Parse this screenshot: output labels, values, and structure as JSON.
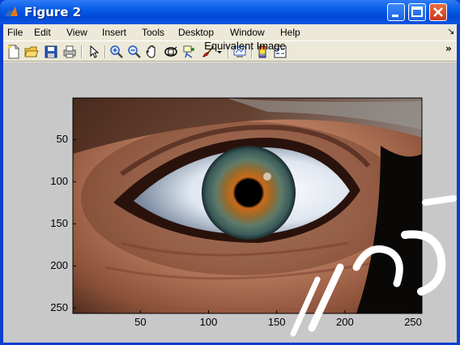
{
  "window": {
    "title": "Figure 2",
    "icon": "matlab-icon",
    "controls": [
      "minimize-icon",
      "maximize-icon",
      "close-icon"
    ]
  },
  "menu": {
    "items": [
      "File",
      "Edit",
      "View",
      "Insert",
      "Tools",
      "Desktop",
      "Window",
      "Help"
    ],
    "overflow": "↘"
  },
  "toolbar": {
    "tools": [
      "new-figure-icon",
      "open-file-icon",
      "save-icon",
      "print-icon",
      "pointer-icon",
      "zoom-in-icon",
      "zoom-out-icon",
      "pan-hand-icon",
      "rotate-3d-icon",
      "data-cursor-icon",
      "brush-icon",
      "brush-dropdown-icon",
      "link-plot-icon",
      "colorbar-icon",
      "legend-icon"
    ],
    "overflow": "»"
  },
  "axes": {
    "title": "Equivalent Image",
    "y_ticks": [
      "50",
      "100",
      "150",
      "200",
      "250"
    ],
    "x_ticks": [
      "50",
      "100",
      "150",
      "200",
      "250"
    ],
    "y_tick_values": [
      50,
      100,
      150,
      200,
      250
    ],
    "x_tick_values": [
      50,
      100,
      150,
      200,
      250
    ],
    "x_range": [
      0.5,
      256.5
    ],
    "y_range": [
      0.5,
      256.5
    ],
    "image": "eye-photo"
  },
  "colors": {
    "title_bar": "#0a5fe8",
    "figure_bg": "#c8c8c8",
    "menu_bg": "#ece9d8",
    "close_button": "#c8361b"
  }
}
